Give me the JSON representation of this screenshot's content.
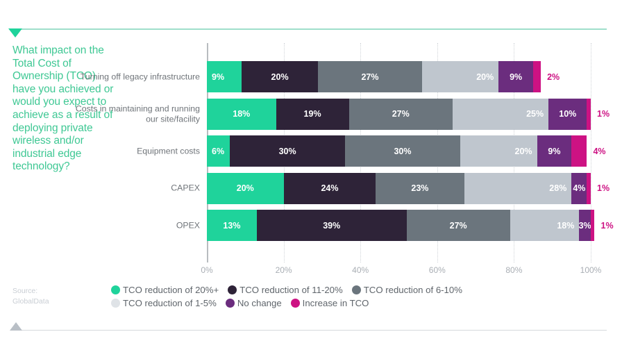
{
  "question": "What impact on the Total Cost of Ownership (TCO) have you achieved or would you expect to achieve as a result of deploying private wireless and/or industrial edge technology?",
  "source": {
    "label": "Source:",
    "name": "GlobalData"
  },
  "colors": {
    "accent_green": "#1fd39b",
    "question_text": "#3fc894",
    "top_rule": "#9fdfcb",
    "bottom_rule": "#d6d9dd",
    "magenta": "#cd1283",
    "axis_text": "#a9aeb4",
    "category_text": "#6f7479",
    "legend_text": "#5f656b",
    "source_text": "#c9ced4"
  },
  "chart_data": {
    "type": "bar",
    "orientation": "horizontal",
    "stacked": true,
    "title": "",
    "xlabel": "",
    "ylabel": "",
    "xlim": [
      0,
      100
    ],
    "xticks": [
      "0%",
      "20%",
      "40%",
      "60%",
      "80%",
      "100%"
    ],
    "xtick_values": [
      0,
      20,
      40,
      60,
      80,
      100
    ],
    "grid": true,
    "legend_position": "bottom",
    "categories": [
      "Turning off legacy infrastructure",
      "Costs in maintaining and running our site/facility",
      "Equipment costs",
      "CAPEX",
      "OPEX"
    ],
    "series": [
      {
        "name": "TCO reduction of 20%+",
        "color": "#1fd39b",
        "values": [
          9,
          18,
          6,
          20,
          13
        ]
      },
      {
        "name": "TCO reduction of 11-20%",
        "color": "#2e2338",
        "values": [
          20,
          19,
          30,
          24,
          39
        ]
      },
      {
        "name": "TCO reduction of 6-10%",
        "color": "#6b757d",
        "values": [
          27,
          27,
          30,
          23,
          27
        ]
      },
      {
        "name": "TCO reduction of 1-5%",
        "color": "#bfc6ce",
        "values": [
          20,
          25,
          20,
          28,
          18
        ]
      },
      {
        "name": "No change",
        "color": "#6b2d7e",
        "values": [
          9,
          10,
          9,
          4,
          3
        ]
      },
      {
        "name": "Increase in TCO",
        "color": "#cd1283",
        "values": [
          2,
          1,
          4,
          1,
          1
        ]
      }
    ],
    "value_labels": [
      [
        "9%",
        "20%",
        "27%",
        "20%",
        "9%",
        "2%"
      ],
      [
        "18%",
        "19%",
        "27%",
        "25%",
        "10%",
        "1%"
      ],
      [
        "6%",
        "30%",
        "30%",
        "20%",
        "9%",
        "4%"
      ],
      [
        "20%",
        "24%",
        "23%",
        "28%",
        "4%",
        "1%"
      ],
      [
        "13%",
        "39%",
        "27%",
        "18%",
        "3%",
        "1%"
      ]
    ]
  },
  "legend": {
    "row1": [
      {
        "label": "TCO reduction of 20%+",
        "color": "#1fd39b"
      },
      {
        "label": "TCO reduction of 11-20%",
        "color": "#2e2338"
      },
      {
        "label": "TCO reduction of 6-10%",
        "color": "#6b757d"
      }
    ],
    "row2": [
      {
        "label": "TCO reduction of 1-5%",
        "color": "#dfe3e7"
      },
      {
        "label": "No change",
        "color": "#6b2d7e"
      },
      {
        "label": "Increase in TCO",
        "color": "#cd1283"
      }
    ]
  }
}
